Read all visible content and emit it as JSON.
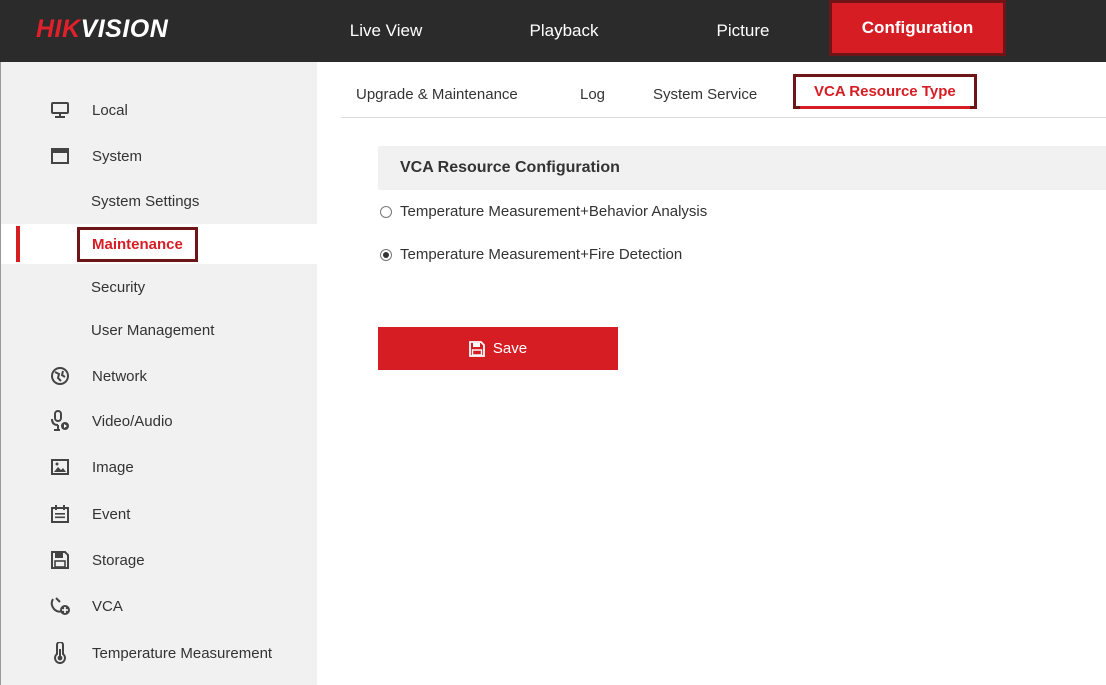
{
  "brand": {
    "part1": "HIK",
    "part2": "VISION"
  },
  "topnav": {
    "items": [
      {
        "label": "Live View"
      },
      {
        "label": "Playback"
      },
      {
        "label": "Picture"
      },
      {
        "label": "Configuration",
        "active": true
      }
    ]
  },
  "sidebar": {
    "items": [
      {
        "label": "Local",
        "icon": "monitor-icon"
      },
      {
        "label": "System",
        "icon": "window-icon"
      },
      {
        "label": "System Settings"
      },
      {
        "label": "Maintenance",
        "active": true
      },
      {
        "label": "Security"
      },
      {
        "label": "User Management"
      },
      {
        "label": "Network",
        "icon": "globe-icon"
      },
      {
        "label": "Video/Audio",
        "icon": "microphone-icon"
      },
      {
        "label": "Image",
        "icon": "image-icon"
      },
      {
        "label": "Event",
        "icon": "calendar-icon"
      },
      {
        "label": "Storage",
        "icon": "floppy-disk-icon"
      },
      {
        "label": "VCA",
        "icon": "vca-icon"
      },
      {
        "label": "Temperature Measurement",
        "icon": "thermometer-icon"
      }
    ]
  },
  "tabs": [
    {
      "label": "Upgrade & Maintenance"
    },
    {
      "label": "Log"
    },
    {
      "label": "System Service"
    },
    {
      "label": "VCA Resource Type",
      "active": true
    }
  ],
  "main": {
    "section_title": "VCA Resource Configuration",
    "options": [
      {
        "label": "Temperature Measurement+Behavior Analysis",
        "checked": false
      },
      {
        "label": "Temperature Measurement+Fire Detection",
        "checked": true
      }
    ],
    "save_label": "Save"
  },
  "colors": {
    "accent": "#d71d24",
    "topbar": "#2b2b2b",
    "highlight_border": "#6e1518",
    "sidebar_bg": "#f1f1f1"
  }
}
